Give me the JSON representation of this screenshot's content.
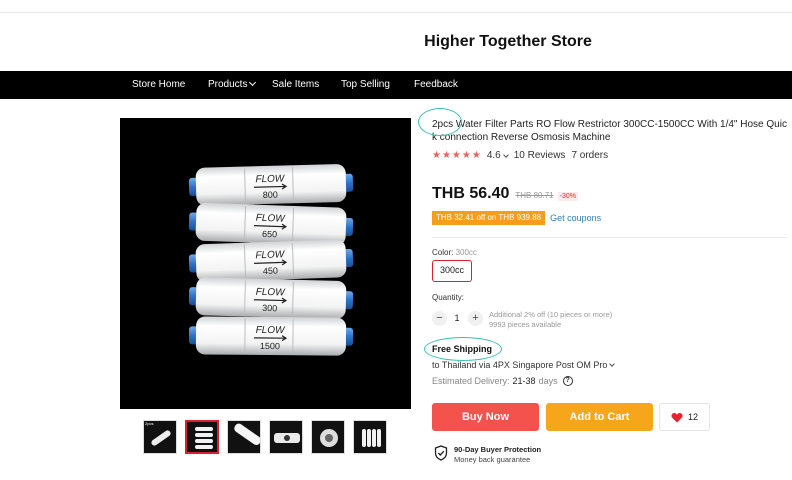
{
  "store": {
    "name": "Higher Together Store"
  },
  "nav": {
    "items": [
      {
        "label": "Store Home",
        "has_dropdown": false
      },
      {
        "label": "Products",
        "has_dropdown": true
      },
      {
        "label": "Sale Items",
        "has_dropdown": false
      },
      {
        "label": "Top Selling",
        "has_dropdown": false
      },
      {
        "label": "Feedback",
        "has_dropdown": false
      }
    ]
  },
  "gallery": {
    "main_image_labels": [
      "800",
      "650",
      "450",
      "300",
      "1500"
    ],
    "filter_text": "FLOW",
    "thumb_tag": "2pcs",
    "thumb_count": 6,
    "active_thumb": 2
  },
  "product": {
    "title": "2pcs Water Filter Parts RO Flow Restrictor 300CC-1500CC With 1/4\" Hose Quick connection Reverse Osmosis Machine",
    "rating": "4.6",
    "stars": 5,
    "reviews": "10 Reviews",
    "orders": "7 orders",
    "price": "THB 56.40",
    "old_price": "THB 80.71",
    "discount": "-30%",
    "coupon_text": "THB 32.41 off on THB 939.88",
    "get_coupons": "Get coupons"
  },
  "variant": {
    "color_label": "Color:",
    "color_value": "300cc",
    "selected_option": "300cc"
  },
  "quantity": {
    "label": "Quantity:",
    "minus": "−",
    "plus": "+",
    "value": "1",
    "note_line1": "Additional 2% off (10 pieces or more)",
    "note_line2": "9993 pieces available"
  },
  "shipping": {
    "title": "Free Shipping",
    "line": "to Thailand via 4PX Singapore Post OM Pro",
    "delivery_label": "Estimated Delivery:",
    "delivery_value": "21-38",
    "delivery_unit": "days"
  },
  "actions": {
    "buy_now": "Buy Now",
    "add_to_cart": "Add to Cart",
    "wishlist_count": "12"
  },
  "protection": {
    "title": "90-Day Buyer Protection",
    "subtitle": "Money back guarantee"
  },
  "colors": {
    "nav_bg": "#000000",
    "buy_now": "#f4524d",
    "add_to_cart": "#f7a61b",
    "coupon_bg": "#f89c1c",
    "annotation_circle": "#3cbfb4",
    "star": "#f25f5c"
  },
  "icons": {
    "nav_chevron": "chevron-down-icon",
    "heart": "heart-icon",
    "help": "help-circle-icon",
    "shield": "shield-check-icon"
  }
}
